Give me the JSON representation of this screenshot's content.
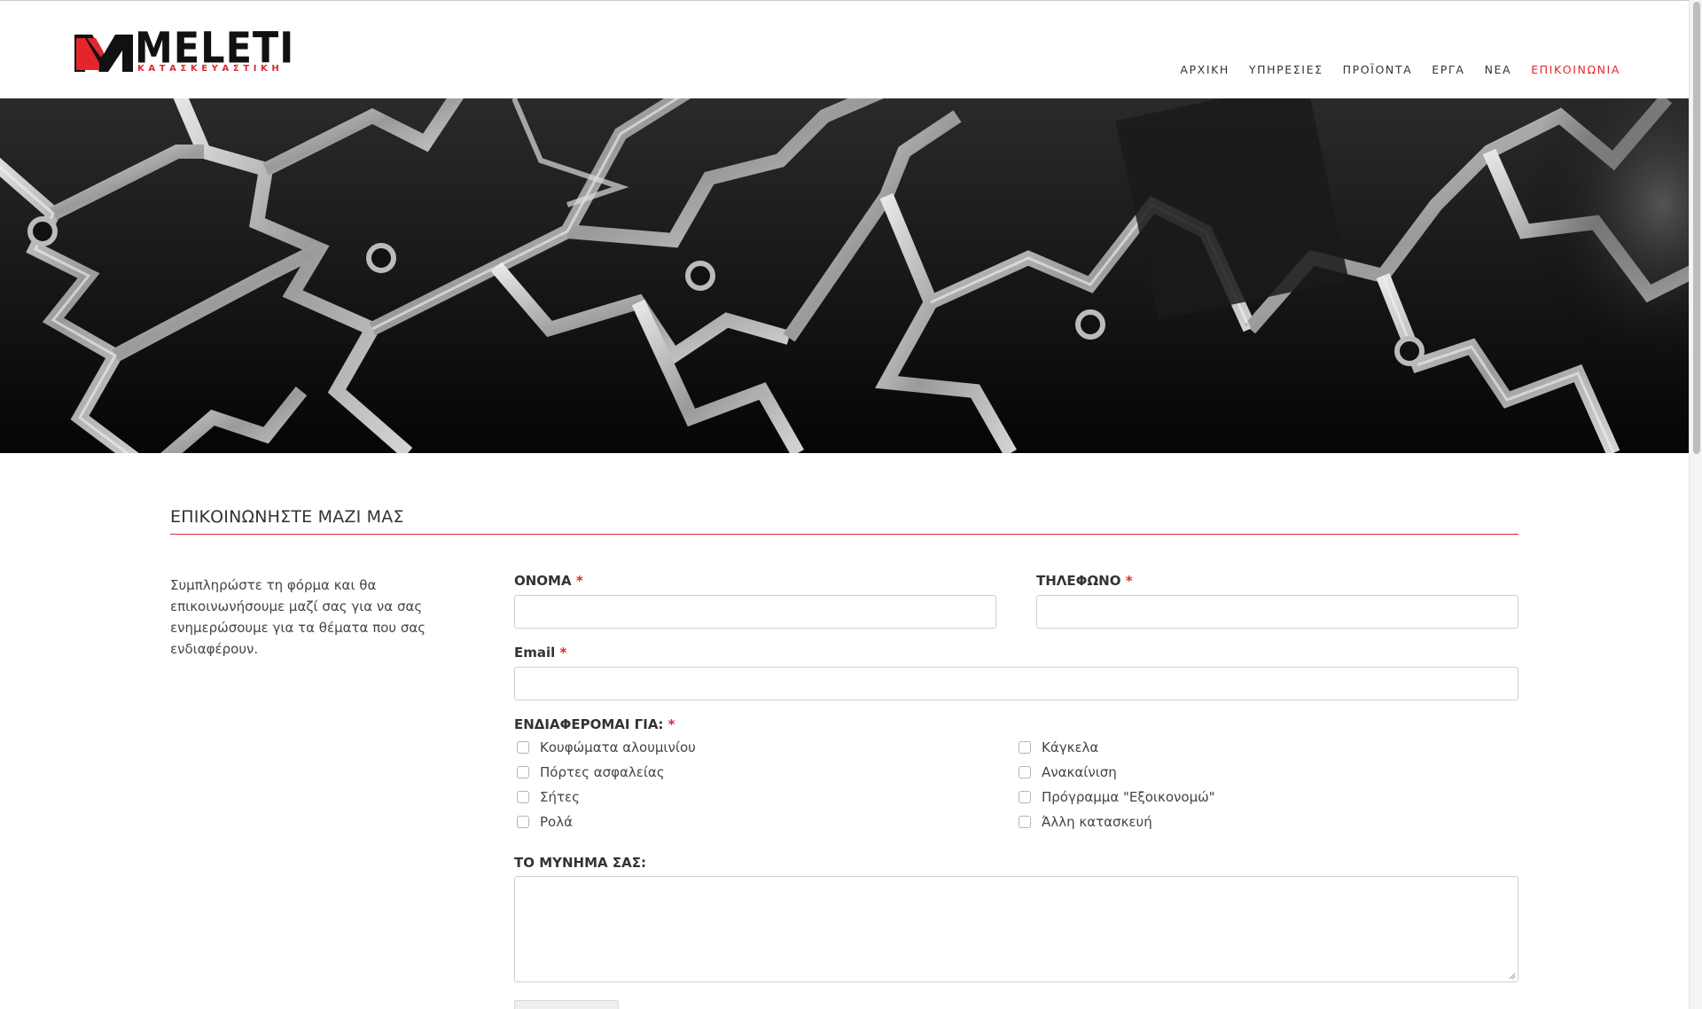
{
  "brand": {
    "name": "MELETI",
    "tagline": "ΚΑΤΑΣΚΕΥΑΣΤΙΚΗ",
    "accent_color": "#e3262b"
  },
  "nav": {
    "items": [
      {
        "label": "ΑΡΧΙΚΗ",
        "active": false
      },
      {
        "label": "ΥΠΗΡΕΣΙΕΣ",
        "active": false
      },
      {
        "label": "ΠΡΟΪΟΝΤΑ",
        "active": false
      },
      {
        "label": "ΕΡΓΑ",
        "active": false
      },
      {
        "label": "ΝΕΑ",
        "active": false
      },
      {
        "label": "ΕΠΙΚΟΙΝΩΝΙΑ",
        "active": true
      }
    ]
  },
  "hero": {
    "image": "aluminium-profiles-photo"
  },
  "contact": {
    "title": "ΕΠΙΚΟΙΝΩΝΗΣΤΕ ΜΑΖΙ ΜΑΣ",
    "intro": "Συμπληρώστε τη φόρμα και θα επικοινωνήσουμε μαζί σας για να σας ενημερώσουμε για τα θέματα που σας ενδιαφέρουν.",
    "required_mark": "*",
    "fields": {
      "name_label": "ΟΝΟΜΑ",
      "name_value": "",
      "phone_label": "ΤΗΛΕΦΩΝΟ",
      "phone_value": "",
      "email_label": "Email",
      "email_value": "",
      "interests_label": "ΕΝΔΙΑΦΕΡΟΜΑΙ ΓΙΑ:",
      "message_label": "ΤΟ ΜΥΝΗΜΑ ΣΑΣ:",
      "message_value": ""
    },
    "interests_left": [
      {
        "label": "Κουφώματα αλουμινίου",
        "checked": false
      },
      {
        "label": "Πόρτες ασφαλείας",
        "checked": false
      },
      {
        "label": "Σήτες",
        "checked": false
      },
      {
        "label": "Ρολά",
        "checked": false
      }
    ],
    "interests_right": [
      {
        "label": "Κάγκελα",
        "checked": false
      },
      {
        "label": "Ανακαίνιση",
        "checked": false
      },
      {
        "label": "Πρόγραμμα \"Εξοικονομώ\"",
        "checked": false
      },
      {
        "label": "Άλλη κατασκευή",
        "checked": false
      }
    ]
  }
}
